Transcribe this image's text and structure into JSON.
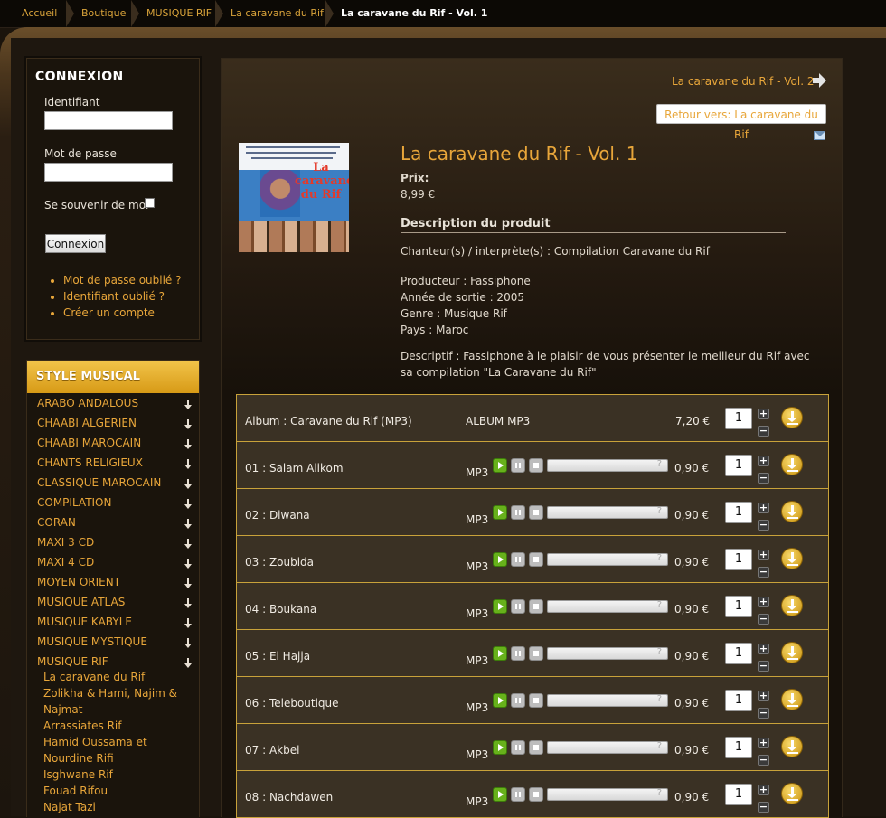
{
  "breadcrumb": {
    "items": [
      "Accueil",
      "Boutique",
      "MUSIQUE RIF",
      "La caravane du Rif"
    ],
    "current": "La caravane du Rif - Vol. 1"
  },
  "login": {
    "title": "CONNEXION",
    "username_label": "Identifiant",
    "username_value": "",
    "password_label": "Mot de passe",
    "password_value": "",
    "remember_label": "Se souvenir de moi",
    "submit_label": "Connexion",
    "links": [
      "Mot de passe oublié ?",
      "Identifiant oublié ?",
      "Créer un compte"
    ]
  },
  "style_musical": {
    "title": "STYLE MUSICAL",
    "categories": [
      "ARABO ANDALOUS",
      "CHAABI ALGERIEN",
      "CHAABI MAROCAIN",
      "CHANTS RELIGIEUX",
      "CLASSIQUE MAROCAIN",
      "COMPILATION",
      "CORAN",
      "MAXI 3 CD",
      "MAXI 4 CD",
      "MOYEN ORIENT",
      "MUSIQUE ATLAS",
      "MUSIQUE KABYLE",
      "MUSIQUE MYSTIQUE",
      "MUSIQUE RIF"
    ],
    "subcategories": [
      "La caravane du Rif",
      "Zolikha & Hami, Najim & Najmat",
      "Arrassiates Rif",
      "Hamid Oussama et Nourdine Rifi",
      "Isghwane Rif",
      "Fouad Rifou",
      "Najat Tazi"
    ]
  },
  "product": {
    "next_link": "La caravane du Rif - Vol. 2",
    "back_link": "Retour vers: La caravane du Rif",
    "title": "La caravane du Rif - Vol. 1",
    "price_label": "Prix:",
    "price": "8,99 €",
    "description_heading": "Description du produit",
    "description_lines": [
      "Chanteur(s) / interprète(s) : Compilation Caravane du Rif",
      "Producteur : Fassiphone",
      "Année de sortie : 2005",
      "Genre : Musique Rif",
      "Pays : Maroc",
      "Descriptif : Fassiphone à le plaisir de vous présenter le meilleur du Rif avec",
      "sa compilation \"La Caravane du Rif\""
    ],
    "cover_art_text": "La caravane du Rif"
  },
  "tracks": {
    "album": {
      "name": "Album : Caravane du Rif (MP3)",
      "type": "ALBUM MP3",
      "price": "7,20 €",
      "qty": "1"
    },
    "items": [
      {
        "name": "01 : Salam Alikom",
        "format": "MP3",
        "price": "0,90 €",
        "qty": "1"
      },
      {
        "name": "02 : Diwana",
        "format": "MP3",
        "price": "0,90 €",
        "qty": "1"
      },
      {
        "name": "03 : Zoubida",
        "format": "MP3",
        "price": "0,90 €",
        "qty": "1"
      },
      {
        "name": "04 : Boukana",
        "format": "MP3",
        "price": "0,90 €",
        "qty": "1"
      },
      {
        "name": "05 : El Hajja",
        "format": "MP3",
        "price": "0,90 €",
        "qty": "1"
      },
      {
        "name": "06 : Teleboutique",
        "format": "MP3",
        "price": "0,90 €",
        "qty": "1"
      },
      {
        "name": "07 : Akbel",
        "format": "MP3",
        "price": "0,90 €",
        "qty": "1"
      },
      {
        "name": "08 : Nachdawen",
        "format": "MP3",
        "price": "0,90 €",
        "qty": "1"
      }
    ],
    "plus_label": "+",
    "minus_label": "−"
  },
  "colors": {
    "accent": "#e8a63a",
    "gold_border": "#c8a23a",
    "play_green": "#67b11b"
  }
}
